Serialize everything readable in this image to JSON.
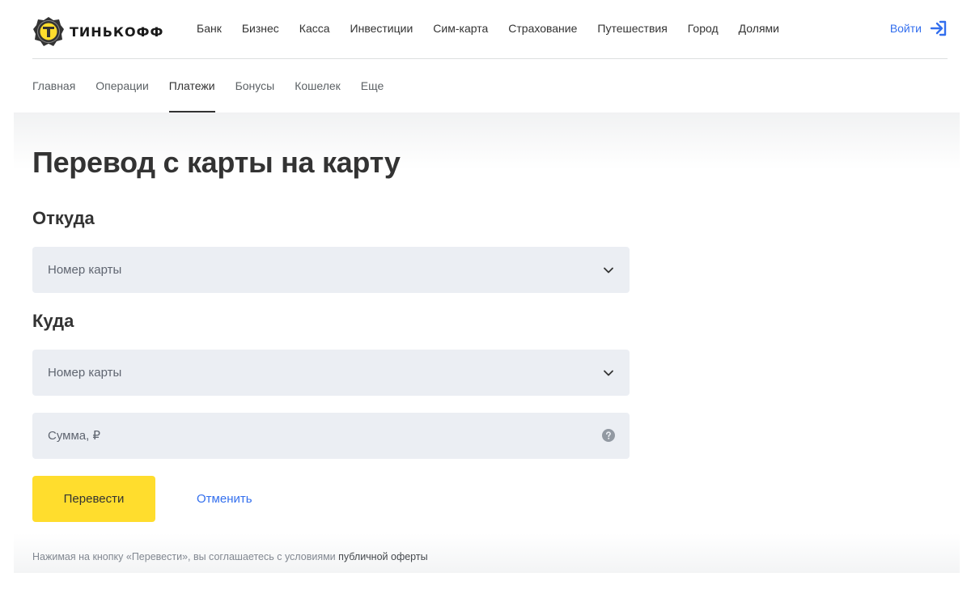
{
  "brand": {
    "name": "ТИНЬКОФФ",
    "accent_color": "#ffdd2d",
    "link_color": "#336fee"
  },
  "header": {
    "nav": [
      "Банк",
      "Бизнес",
      "Касса",
      "Инвестиции",
      "Сим-карта",
      "Страхование",
      "Путешествия",
      "Город",
      "Долями"
    ],
    "login_label": "Войти",
    "login_icon": "login-arrow-icon"
  },
  "subnav": {
    "items": [
      "Главная",
      "Операции",
      "Платежи",
      "Бонусы",
      "Кошелек",
      "Еще"
    ],
    "active": "Платежи"
  },
  "form": {
    "title": "Перевод с карты на карту",
    "from": {
      "heading": "Откуда",
      "placeholder": "Номер карты",
      "icon": "chevron-down-icon"
    },
    "to": {
      "heading": "Куда",
      "placeholder": "Номер карты",
      "icon": "chevron-down-icon"
    },
    "amount": {
      "placeholder": "Сумма, ₽",
      "icon": "question-circle-icon"
    },
    "submit_label": "Перевести",
    "cancel_label": "Отменить",
    "disclaimer_text": "Нажимая на кнопку «Перевести», вы соглашаетесь с условиями ",
    "disclaimer_link": "публичной оферты"
  }
}
